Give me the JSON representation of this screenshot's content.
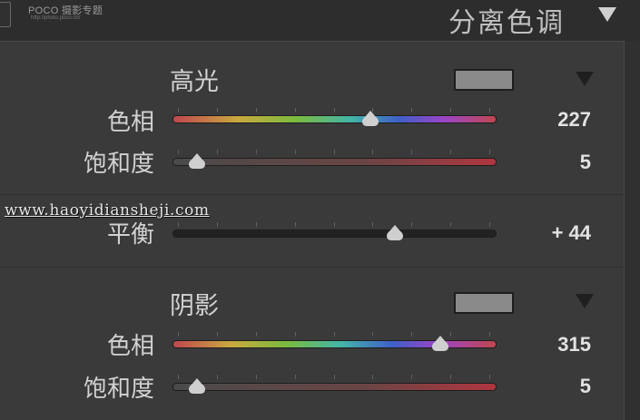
{
  "header": {
    "watermark_logo": "POCO 摄影专题",
    "watermark_url": "http://photo.poco.cn/",
    "title": "分离色调"
  },
  "highlights": {
    "title": "高光",
    "swatch_color": "#8a8a8a",
    "hue": {
      "label": "色相",
      "value": "227",
      "fraction": 0.62
    },
    "saturation": {
      "label": "饱和度",
      "value": "5",
      "fraction": 0.05
    }
  },
  "balance": {
    "label": "平衡",
    "value": "+ 44",
    "fraction": 0.7
  },
  "shadows": {
    "title": "阴影",
    "swatch_color": "#8a8a8a",
    "hue": {
      "label": "色相",
      "value": "315",
      "fraction": 0.85
    },
    "saturation": {
      "label": "饱和度",
      "value": "5",
      "fraction": 0.05
    }
  },
  "watermark": {
    "site": "www.haoyidiansheji.com"
  },
  "icons": {
    "panel_collapse": "triangle-down-icon",
    "section_collapse": "triangle-down-icon",
    "slider_thumb": "slider-thumb-icon"
  }
}
